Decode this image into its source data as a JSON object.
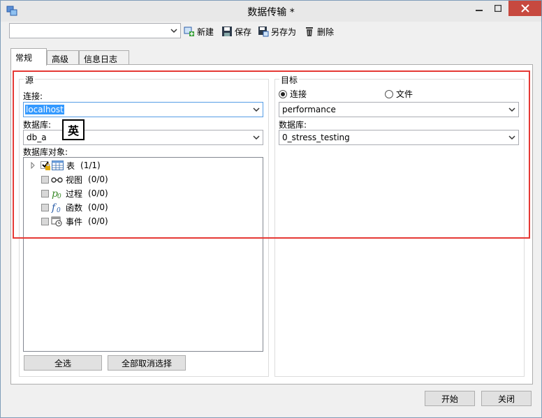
{
  "window": {
    "title": "数据传输 *"
  },
  "toolbar": {
    "profile_value": "",
    "new_label": "新建",
    "save_label": "保存",
    "save_as_label": "另存为",
    "delete_label": "删除"
  },
  "tabs": [
    {
      "label": "常规",
      "active": true
    },
    {
      "label": "高级",
      "active": false
    },
    {
      "label": "信息日志",
      "active": false
    }
  ],
  "source": {
    "group_label": "源",
    "connection_label": "连接:",
    "connection_value": "localhost",
    "database_label": "数据库:",
    "database_value": "db_a",
    "objects_label": "数据库对象:",
    "objects": [
      {
        "label": "表",
        "count": "(1/1)",
        "icon": "table-icon",
        "state": "checked"
      },
      {
        "label": "视图",
        "count": "(0/0)",
        "icon": "view-icon",
        "state": "empty"
      },
      {
        "label": "过程",
        "count": "(0/0)",
        "icon": "procedure-icon",
        "state": "empty"
      },
      {
        "label": "函数",
        "count": "(0/0)",
        "icon": "function-icon",
        "state": "empty"
      },
      {
        "label": "事件",
        "count": "(0/0)",
        "icon": "event-icon",
        "state": "empty"
      }
    ],
    "select_all_label": "全选",
    "deselect_all_label": "全部取消选择"
  },
  "target": {
    "group_label": "目标",
    "radio_connection_label": "连接",
    "radio_file_label": "文件",
    "selected_radio": "connection",
    "connection_value": "performance",
    "database_label": "数据库:",
    "database_value": "0_stress_testing"
  },
  "ime_indicator": "英",
  "footer": {
    "start_label": "开始",
    "close_label": "关闭"
  },
  "colors": {
    "highlight_border": "#e53935",
    "close_button": "#c7493f",
    "selection": "#3399ff"
  }
}
